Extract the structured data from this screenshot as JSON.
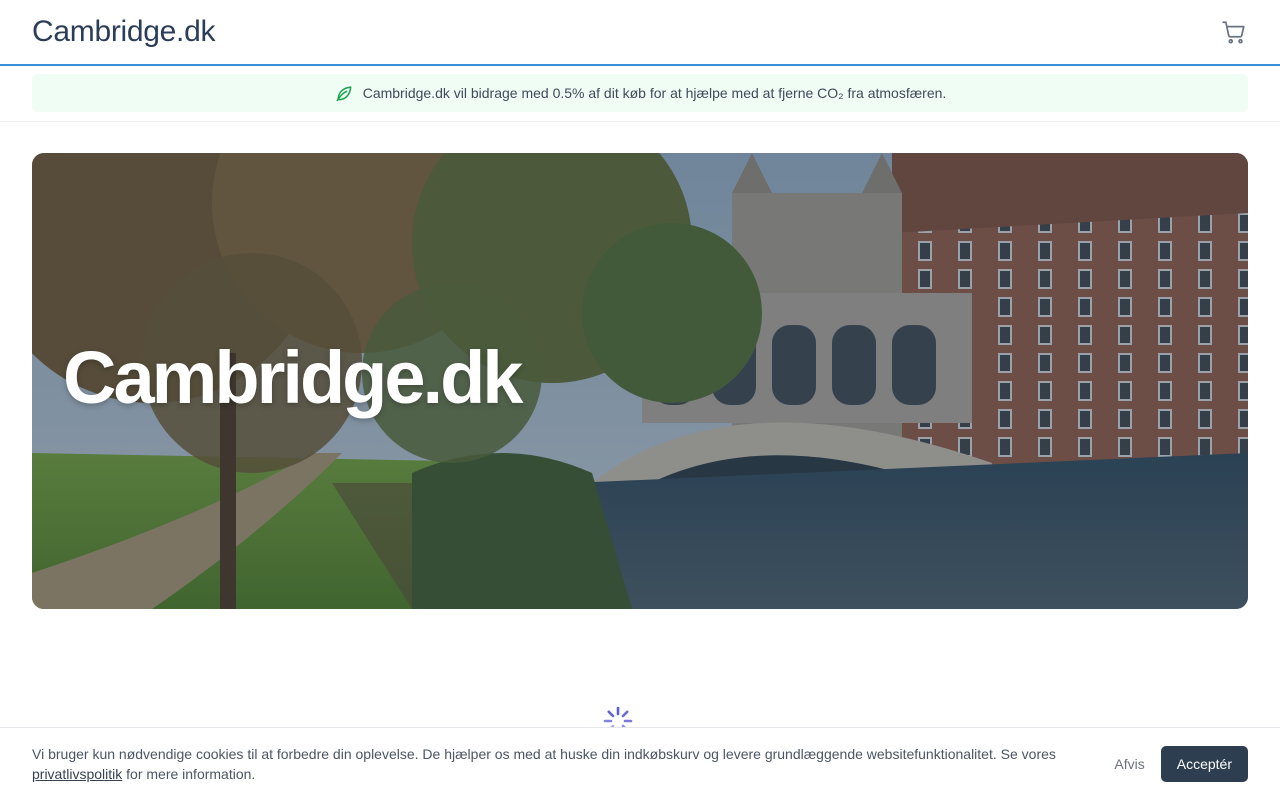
{
  "header": {
    "brand": "Cambridge.dk",
    "cart_icon": "shopping-cart-icon"
  },
  "eco_banner": {
    "icon": "leaf-icon",
    "text": "Cambridge.dk vil bidrage med 0.5% af dit køb for at hjælpe med at fjerne CO₂ fra atmosfæren."
  },
  "hero": {
    "title": "Cambridge.dk"
  },
  "loading": {
    "icon": "spinner-icon"
  },
  "cookie_banner": {
    "text_before": "Vi bruger kun nødvendige cookies til at forbedre din oplevelse. De hjælper os med at huske din indkøbskurv og levere grundlæggende websitefunktionalitet. Se vores ",
    "link": "privatlivspolitik",
    "text_after": " for mere information.",
    "decline_label": "Afvis",
    "accept_label": "Acceptér"
  },
  "colors": {
    "header_border": "#3b8fd6",
    "eco_background": "#f0fdf4",
    "eco_icon": "#16a34a",
    "accept_button": "#2c3e50",
    "spinner": "#5b5bd6"
  }
}
